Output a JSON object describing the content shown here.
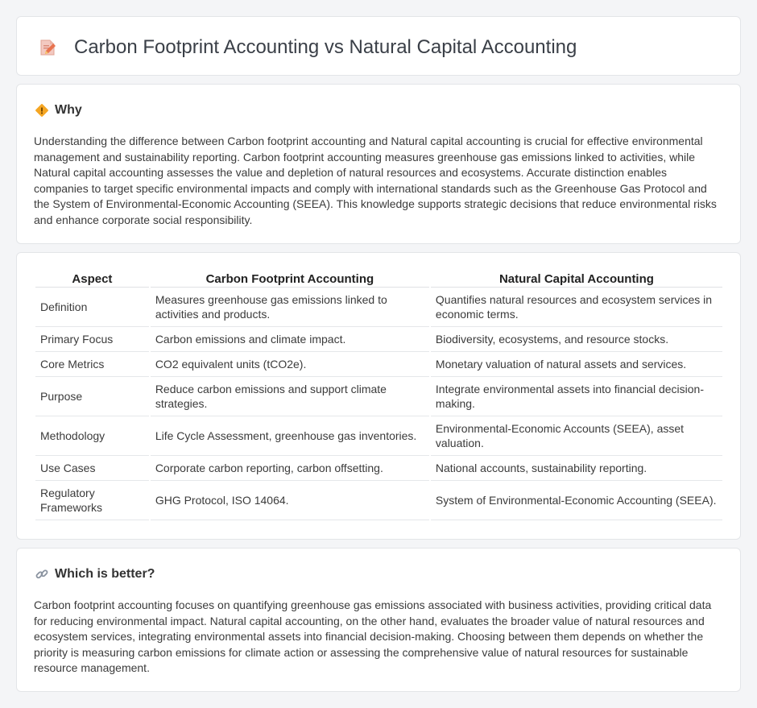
{
  "header": {
    "title": "Carbon Footprint Accounting vs Natural Capital Accounting",
    "icon": "document-edit-icon"
  },
  "why": {
    "heading": "Why",
    "icon": "diamond-sign-icon",
    "text": "Understanding the difference between Carbon footprint accounting and Natural capital accounting is crucial for effective environmental management and sustainability reporting. Carbon footprint accounting measures greenhouse gas emissions linked to activities, while Natural capital accounting assesses the value and depletion of natural resources and ecosystems. Accurate distinction enables companies to target specific environmental impacts and comply with international standards such as the Greenhouse Gas Protocol and the System of Environmental-Economic Accounting (SEEA). This knowledge supports strategic decisions that reduce environmental risks and enhance corporate social responsibility."
  },
  "table": {
    "headers": [
      "Aspect",
      "Carbon Footprint Accounting",
      "Natural Capital Accounting"
    ],
    "rows": [
      [
        "Definition",
        "Measures greenhouse gas emissions linked to activities and products.",
        "Quantifies natural resources and ecosystem services in economic terms."
      ],
      [
        "Primary Focus",
        "Carbon emissions and climate impact.",
        "Biodiversity, ecosystems, and resource stocks."
      ],
      [
        "Core Metrics",
        "CO2 equivalent units (tCO2e).",
        "Monetary valuation of natural assets and services."
      ],
      [
        "Purpose",
        "Reduce carbon emissions and support climate strategies.",
        "Integrate environmental assets into financial decision-making."
      ],
      [
        "Methodology",
        "Life Cycle Assessment, greenhouse gas inventories.",
        "Environmental-Economic Accounts (SEEA), asset valuation."
      ],
      [
        "Use Cases",
        "Corporate carbon reporting, carbon offsetting.",
        "National accounts, sustainability reporting."
      ],
      [
        "Regulatory Frameworks",
        "GHG Protocol, ISO 14064.",
        "System of Environmental-Economic Accounting (SEEA)."
      ]
    ]
  },
  "better": {
    "heading": "Which is better?",
    "icon": "link-icon",
    "text": "Carbon footprint accounting focuses on quantifying greenhouse gas emissions associated with business activities, providing critical data for reducing environmental impact. Natural capital accounting, on the other hand, evaluates the broader value of natural resources and ecosystem services, integrating environmental assets into financial decision-making. Choosing between them depends on whether the priority is measuring carbon emissions for climate action or assessing the comprehensive value of natural resources for sustainable resource management."
  }
}
